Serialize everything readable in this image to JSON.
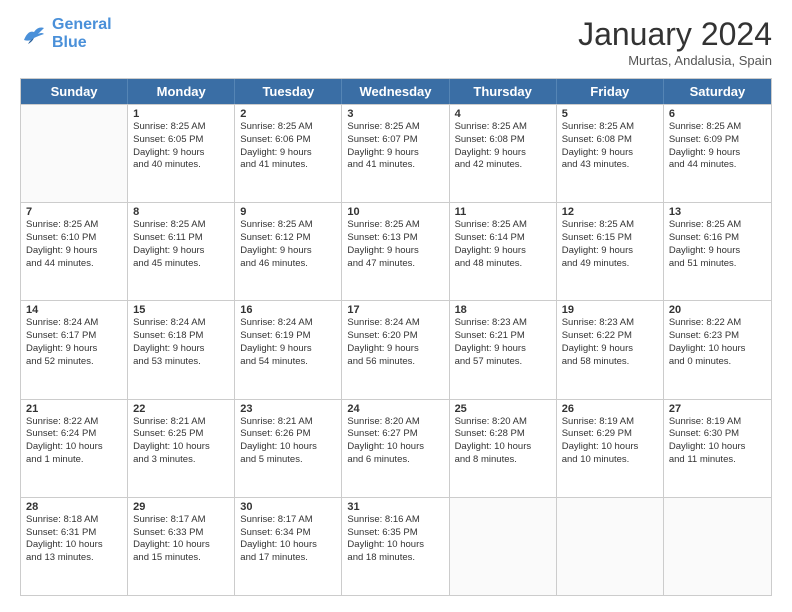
{
  "header": {
    "logo_line1": "General",
    "logo_line2": "Blue",
    "month": "January 2024",
    "location": "Murtas, Andalusia, Spain"
  },
  "weekdays": [
    "Sunday",
    "Monday",
    "Tuesday",
    "Wednesday",
    "Thursday",
    "Friday",
    "Saturday"
  ],
  "weeks": [
    [
      {
        "day": "",
        "lines": []
      },
      {
        "day": "1",
        "lines": [
          "Sunrise: 8:25 AM",
          "Sunset: 6:05 PM",
          "Daylight: 9 hours",
          "and 40 minutes."
        ]
      },
      {
        "day": "2",
        "lines": [
          "Sunrise: 8:25 AM",
          "Sunset: 6:06 PM",
          "Daylight: 9 hours",
          "and 41 minutes."
        ]
      },
      {
        "day": "3",
        "lines": [
          "Sunrise: 8:25 AM",
          "Sunset: 6:07 PM",
          "Daylight: 9 hours",
          "and 41 minutes."
        ]
      },
      {
        "day": "4",
        "lines": [
          "Sunrise: 8:25 AM",
          "Sunset: 6:08 PM",
          "Daylight: 9 hours",
          "and 42 minutes."
        ]
      },
      {
        "day": "5",
        "lines": [
          "Sunrise: 8:25 AM",
          "Sunset: 6:08 PM",
          "Daylight: 9 hours",
          "and 43 minutes."
        ]
      },
      {
        "day": "6",
        "lines": [
          "Sunrise: 8:25 AM",
          "Sunset: 6:09 PM",
          "Daylight: 9 hours",
          "and 44 minutes."
        ]
      }
    ],
    [
      {
        "day": "7",
        "lines": [
          "Sunrise: 8:25 AM",
          "Sunset: 6:10 PM",
          "Daylight: 9 hours",
          "and 44 minutes."
        ]
      },
      {
        "day": "8",
        "lines": [
          "Sunrise: 8:25 AM",
          "Sunset: 6:11 PM",
          "Daylight: 9 hours",
          "and 45 minutes."
        ]
      },
      {
        "day": "9",
        "lines": [
          "Sunrise: 8:25 AM",
          "Sunset: 6:12 PM",
          "Daylight: 9 hours",
          "and 46 minutes."
        ]
      },
      {
        "day": "10",
        "lines": [
          "Sunrise: 8:25 AM",
          "Sunset: 6:13 PM",
          "Daylight: 9 hours",
          "and 47 minutes."
        ]
      },
      {
        "day": "11",
        "lines": [
          "Sunrise: 8:25 AM",
          "Sunset: 6:14 PM",
          "Daylight: 9 hours",
          "and 48 minutes."
        ]
      },
      {
        "day": "12",
        "lines": [
          "Sunrise: 8:25 AM",
          "Sunset: 6:15 PM",
          "Daylight: 9 hours",
          "and 49 minutes."
        ]
      },
      {
        "day": "13",
        "lines": [
          "Sunrise: 8:25 AM",
          "Sunset: 6:16 PM",
          "Daylight: 9 hours",
          "and 51 minutes."
        ]
      }
    ],
    [
      {
        "day": "14",
        "lines": [
          "Sunrise: 8:24 AM",
          "Sunset: 6:17 PM",
          "Daylight: 9 hours",
          "and 52 minutes."
        ]
      },
      {
        "day": "15",
        "lines": [
          "Sunrise: 8:24 AM",
          "Sunset: 6:18 PM",
          "Daylight: 9 hours",
          "and 53 minutes."
        ]
      },
      {
        "day": "16",
        "lines": [
          "Sunrise: 8:24 AM",
          "Sunset: 6:19 PM",
          "Daylight: 9 hours",
          "and 54 minutes."
        ]
      },
      {
        "day": "17",
        "lines": [
          "Sunrise: 8:24 AM",
          "Sunset: 6:20 PM",
          "Daylight: 9 hours",
          "and 56 minutes."
        ]
      },
      {
        "day": "18",
        "lines": [
          "Sunrise: 8:23 AM",
          "Sunset: 6:21 PM",
          "Daylight: 9 hours",
          "and 57 minutes."
        ]
      },
      {
        "day": "19",
        "lines": [
          "Sunrise: 8:23 AM",
          "Sunset: 6:22 PM",
          "Daylight: 9 hours",
          "and 58 minutes."
        ]
      },
      {
        "day": "20",
        "lines": [
          "Sunrise: 8:22 AM",
          "Sunset: 6:23 PM",
          "Daylight: 10 hours",
          "and 0 minutes."
        ]
      }
    ],
    [
      {
        "day": "21",
        "lines": [
          "Sunrise: 8:22 AM",
          "Sunset: 6:24 PM",
          "Daylight: 10 hours",
          "and 1 minute."
        ]
      },
      {
        "day": "22",
        "lines": [
          "Sunrise: 8:21 AM",
          "Sunset: 6:25 PM",
          "Daylight: 10 hours",
          "and 3 minutes."
        ]
      },
      {
        "day": "23",
        "lines": [
          "Sunrise: 8:21 AM",
          "Sunset: 6:26 PM",
          "Daylight: 10 hours",
          "and 5 minutes."
        ]
      },
      {
        "day": "24",
        "lines": [
          "Sunrise: 8:20 AM",
          "Sunset: 6:27 PM",
          "Daylight: 10 hours",
          "and 6 minutes."
        ]
      },
      {
        "day": "25",
        "lines": [
          "Sunrise: 8:20 AM",
          "Sunset: 6:28 PM",
          "Daylight: 10 hours",
          "and 8 minutes."
        ]
      },
      {
        "day": "26",
        "lines": [
          "Sunrise: 8:19 AM",
          "Sunset: 6:29 PM",
          "Daylight: 10 hours",
          "and 10 minutes."
        ]
      },
      {
        "day": "27",
        "lines": [
          "Sunrise: 8:19 AM",
          "Sunset: 6:30 PM",
          "Daylight: 10 hours",
          "and 11 minutes."
        ]
      }
    ],
    [
      {
        "day": "28",
        "lines": [
          "Sunrise: 8:18 AM",
          "Sunset: 6:31 PM",
          "Daylight: 10 hours",
          "and 13 minutes."
        ]
      },
      {
        "day": "29",
        "lines": [
          "Sunrise: 8:17 AM",
          "Sunset: 6:33 PM",
          "Daylight: 10 hours",
          "and 15 minutes."
        ]
      },
      {
        "day": "30",
        "lines": [
          "Sunrise: 8:17 AM",
          "Sunset: 6:34 PM",
          "Daylight: 10 hours",
          "and 17 minutes."
        ]
      },
      {
        "day": "31",
        "lines": [
          "Sunrise: 8:16 AM",
          "Sunset: 6:35 PM",
          "Daylight: 10 hours",
          "and 18 minutes."
        ]
      },
      {
        "day": "",
        "lines": []
      },
      {
        "day": "",
        "lines": []
      },
      {
        "day": "",
        "lines": []
      }
    ]
  ]
}
